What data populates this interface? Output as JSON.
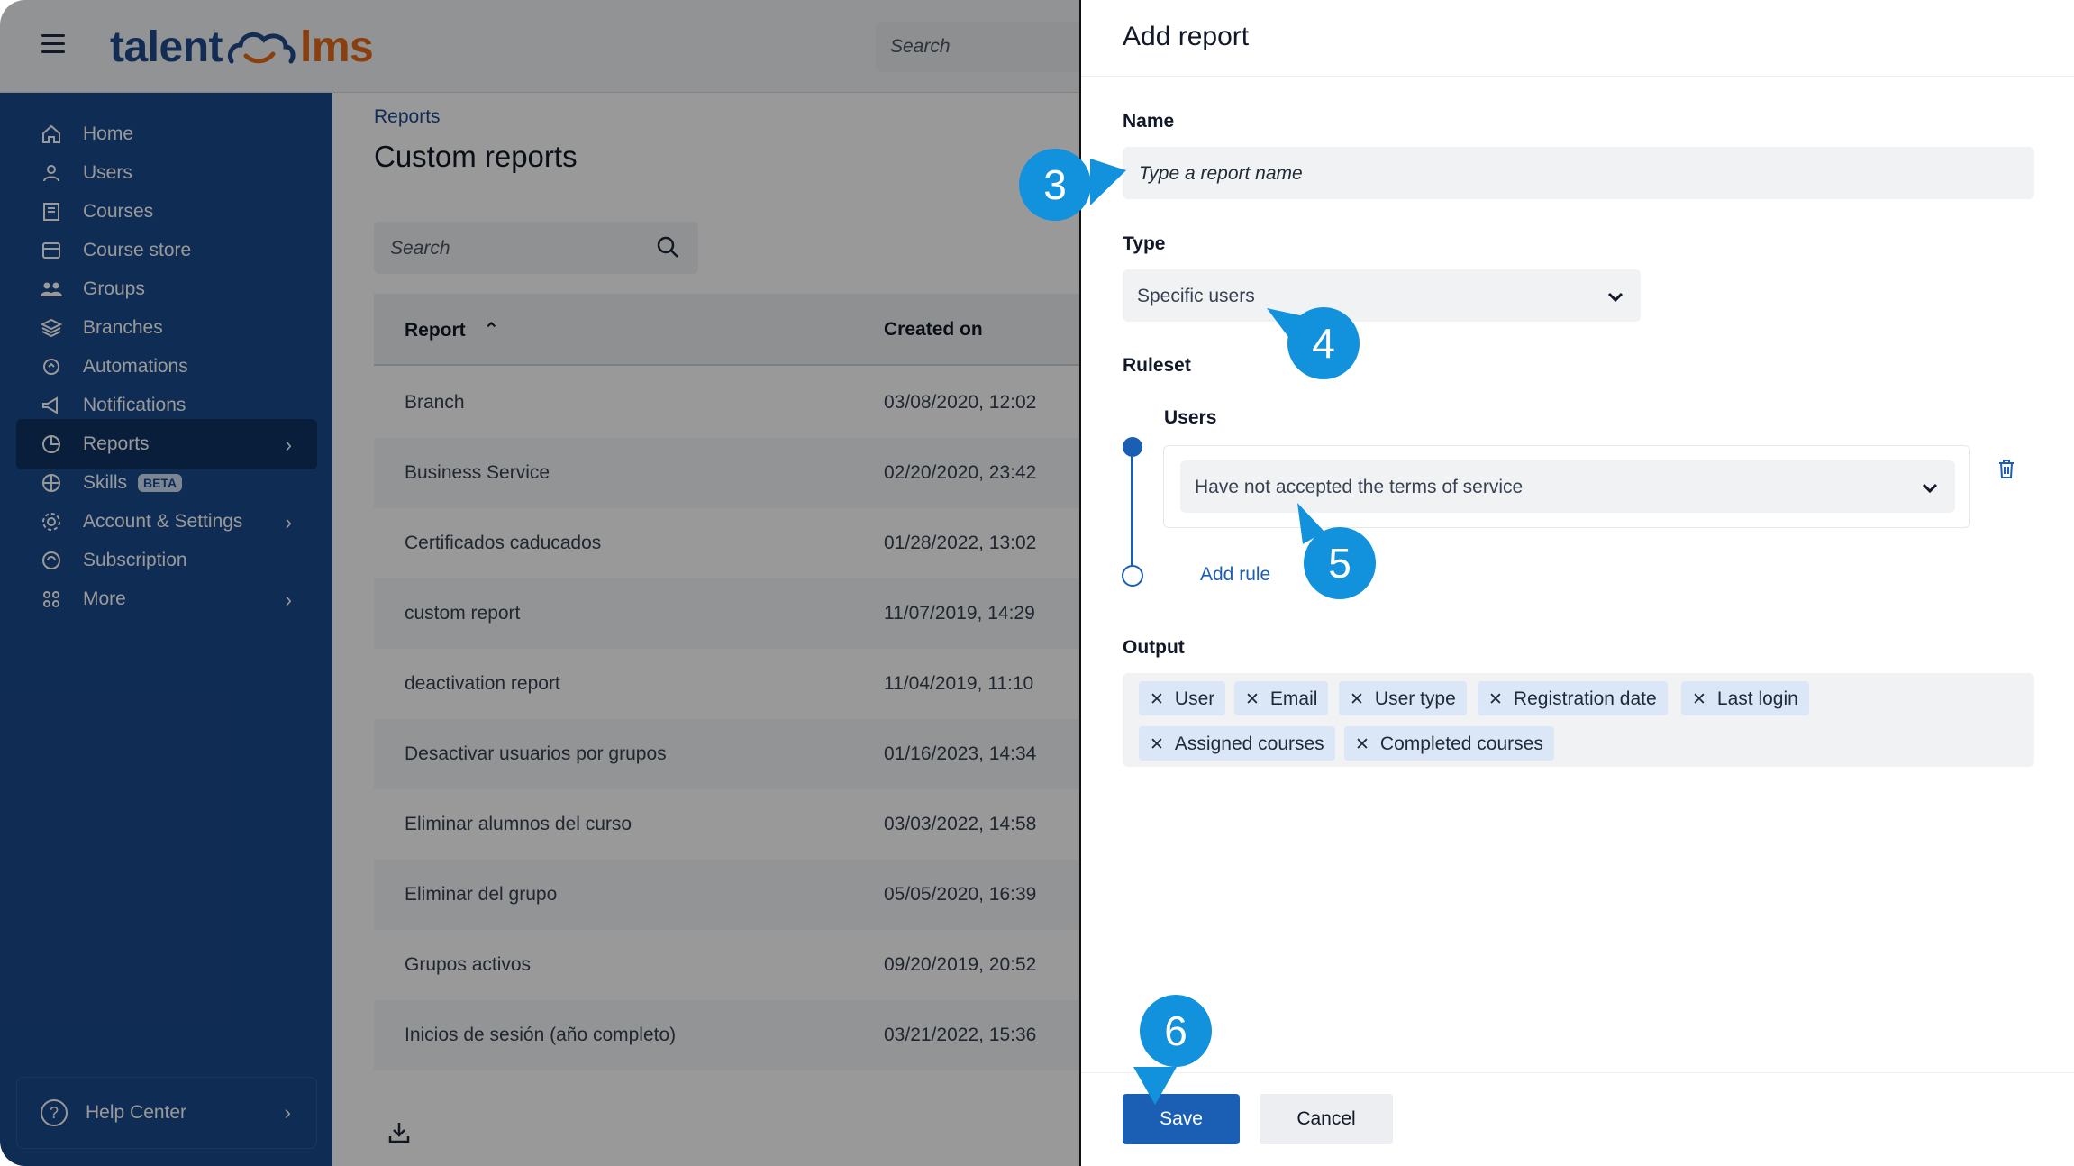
{
  "app": {
    "logo_left": "talent",
    "logo_right": "lms",
    "top_search_placeholder": "Search"
  },
  "sidebar": {
    "items": [
      {
        "label": "Home",
        "icon": "home-icon"
      },
      {
        "label": "Users",
        "icon": "user-icon"
      },
      {
        "label": "Courses",
        "icon": "book-icon"
      },
      {
        "label": "Course store",
        "icon": "store-icon"
      },
      {
        "label": "Groups",
        "icon": "groups-icon"
      },
      {
        "label": "Branches",
        "icon": "layers-icon"
      },
      {
        "label": "Automations",
        "icon": "automation-icon"
      },
      {
        "label": "Notifications",
        "icon": "megaphone-icon"
      },
      {
        "label": "Reports",
        "icon": "pie-chart-icon",
        "active": true
      },
      {
        "label": "Skills",
        "icon": "skills-icon",
        "badge": "BETA"
      },
      {
        "label": "Account & Settings",
        "icon": "gear-icon"
      },
      {
        "label": "Subscription",
        "icon": "subscription-icon"
      },
      {
        "label": "More",
        "icon": "grid-icon"
      }
    ],
    "help": "Help Center"
  },
  "main": {
    "breadcrumb": "Reports",
    "title": "Custom reports",
    "search_placeholder": "Search",
    "columns": [
      "Report",
      "Created on"
    ],
    "rows": [
      [
        "Branch",
        "03/08/2020, 12:02"
      ],
      [
        "Business Service",
        "02/20/2020, 23:42"
      ],
      [
        "Certificados caducados",
        "01/28/2022, 13:02"
      ],
      [
        "custom report",
        "11/07/2019, 14:29"
      ],
      [
        "deactivation report",
        "11/04/2019, 11:10"
      ],
      [
        "Desactivar usuarios por grupos",
        "01/16/2023, 14:34"
      ],
      [
        "Eliminar alumnos del curso",
        "03/03/2022, 14:58"
      ],
      [
        "Eliminar del grupo",
        "05/05/2020, 16:39"
      ],
      [
        "Grupos activos",
        "09/20/2019, 20:52"
      ],
      [
        "Inicios de sesión (año completo)",
        "03/21/2022, 15:36"
      ]
    ]
  },
  "drawer": {
    "title": "Add report",
    "name_label": "Name",
    "name_placeholder": "Type a report name",
    "type_label": "Type",
    "type_value": "Specific users",
    "ruleset_label": "Ruleset",
    "rule_group_label": "Users",
    "rule_value": "Have not accepted the terms of service",
    "add_rule": "Add rule",
    "output_label": "Output",
    "output_tags": [
      "User",
      "Email",
      "User type",
      "Registration date",
      "Last login",
      "Assigned courses",
      "Completed courses"
    ],
    "save": "Save",
    "cancel": "Cancel"
  },
  "callouts": [
    "3",
    "4",
    "5",
    "6"
  ],
  "colors": {
    "brand_blue": "#1a4a8d",
    "brand_orange": "#e46a1c",
    "primary_button": "#1a5fb4",
    "callout": "#1291dc"
  }
}
